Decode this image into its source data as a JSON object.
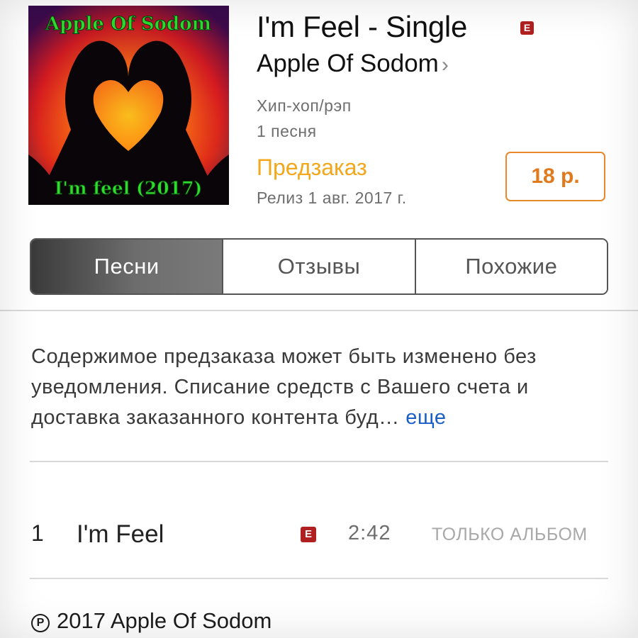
{
  "album": {
    "art_top_text": "Apple Of Sodom",
    "art_bottom_text": "I'm feel (2017)",
    "title": "I'm Feel - Single",
    "explicit_label": "E",
    "artist": "Apple Of Sodom",
    "artist_chevron": "›",
    "genre": "Хип-хоп/рэп",
    "song_count": "1 песня",
    "status": "Предзаказ",
    "release": "Релиз 1 авг. 2017 г.",
    "price": "18 р."
  },
  "tabs": [
    {
      "label": "Песни",
      "active": true
    },
    {
      "label": "Отзывы",
      "active": false
    },
    {
      "label": "Похожие",
      "active": false
    }
  ],
  "description": {
    "text": "Содержимое предзаказа может быть изменено без уведомления. Списание средств с Вашего счета и доставка заказанного контента буд…",
    "more": " еще"
  },
  "tracks": [
    {
      "number": "1",
      "name": "I'm Feel",
      "explicit": "E",
      "duration": "2:42",
      "availability": "ТОЛЬКО АЛЬБОМ"
    }
  ],
  "copyright": {
    "symbol": "P",
    "text": "2017 Apple Of Sodom"
  },
  "colors": {
    "preorder": "#f3a71b",
    "price_border": "#e8892b",
    "more_link": "#1a5fc8",
    "explicit_badge": "#b02020",
    "art_text": "#2edc2e"
  },
  "icons": [
    "chevron-right-icon",
    "explicit-icon",
    "phonogram-copyright-icon"
  ]
}
